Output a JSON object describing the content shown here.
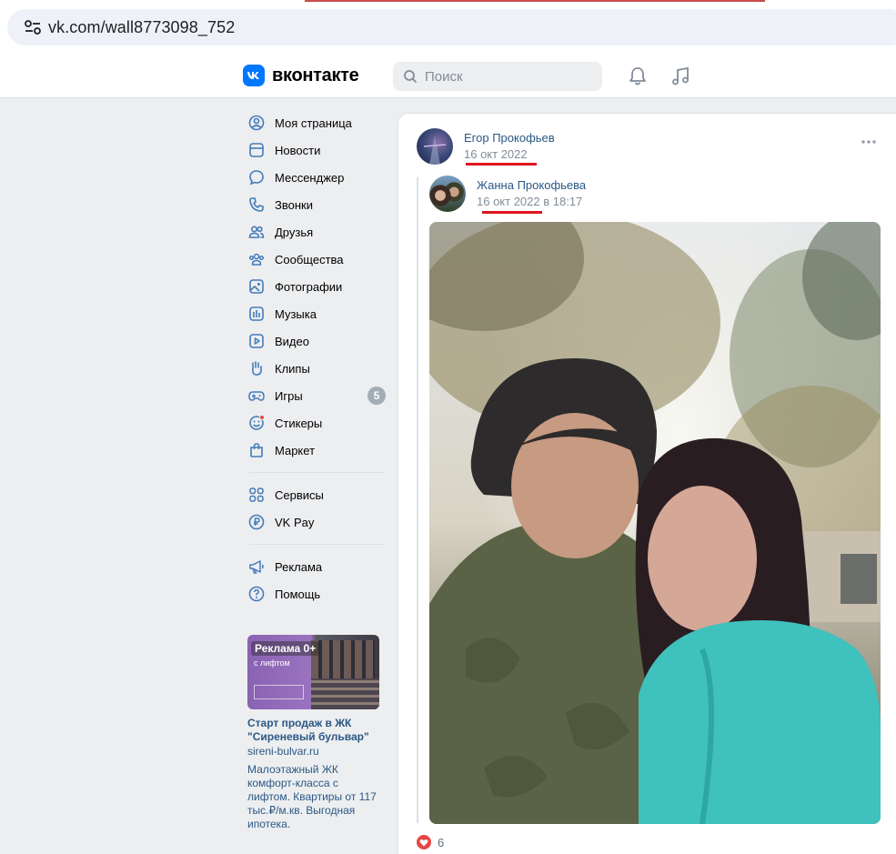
{
  "browser": {
    "url": "vk.com/wall8773098_752"
  },
  "header": {
    "logo_text": "вконтакте",
    "logo_icon": "vk-logo",
    "search_placeholder": "Поиск",
    "icons": [
      "bell-icon",
      "music-icon"
    ]
  },
  "sidebar": {
    "items": [
      {
        "label": "Моя страница",
        "icon": "user-icon"
      },
      {
        "label": "Новости",
        "icon": "news-icon"
      },
      {
        "label": "Мессенджер",
        "icon": "chat-icon"
      },
      {
        "label": "Звонки",
        "icon": "phone-icon"
      },
      {
        "label": "Друзья",
        "icon": "friends-icon"
      },
      {
        "label": "Сообщества",
        "icon": "communities-icon"
      },
      {
        "label": "Фотографии",
        "icon": "photo-icon"
      },
      {
        "label": "Музыка",
        "icon": "music-icon"
      },
      {
        "label": "Видео",
        "icon": "video-icon"
      },
      {
        "label": "Клипы",
        "icon": "clips-icon"
      },
      {
        "label": "Игры",
        "icon": "gamepad-icon",
        "badge": "5"
      },
      {
        "label": "Стикеры",
        "icon": "sticker-icon"
      },
      {
        "label": "Маркет",
        "icon": "bag-icon"
      }
    ],
    "items2": [
      {
        "label": "Сервисы",
        "icon": "services-icon"
      },
      {
        "label": "VK Pay",
        "icon": "vkpay-icon"
      }
    ],
    "items3": [
      {
        "label": "Реклама",
        "icon": "megaphone-icon"
      },
      {
        "label": "Помощь",
        "icon": "help-icon"
      }
    ]
  },
  "ad": {
    "badge": "Реклама 0+",
    "image_text": "с лифтом",
    "title": "Старт продаж в ЖК \"Сиреневый бульвар\"",
    "domain": "sireni-bulvar.ru",
    "description": "Малоэтажный ЖК комфорт-класса с лифтом. Квартиры от 117 тыс.₽/м.кв. Выгодная ипотека."
  },
  "post": {
    "author": "Егор Прокофьев",
    "date": "16 окт 2022",
    "repost": {
      "author": "Жанна Прокофьева",
      "date": "16 окт 2022 в 18:17"
    },
    "likes": "6"
  },
  "colors": {
    "accent": "#0077ff",
    "link": "#2a5885",
    "muted": "#818c99",
    "underline_red": "#e0141e",
    "like_red": "#e64646"
  }
}
